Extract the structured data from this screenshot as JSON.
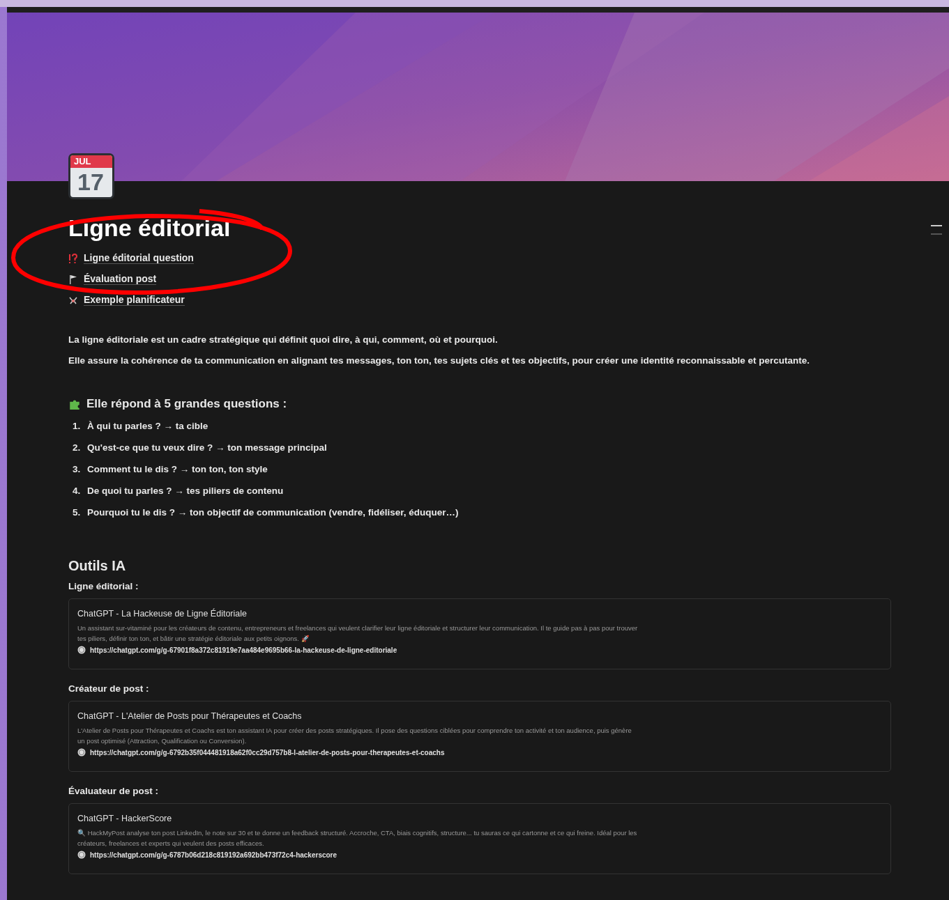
{
  "page": {
    "icon_month": "JUL",
    "icon_day": "17",
    "title": "Ligne éditorial"
  },
  "subpages": [
    {
      "kind": "question",
      "label": "Ligne éditorial question"
    },
    {
      "kind": "flag",
      "label": "Évaluation post"
    },
    {
      "kind": "carousel",
      "label": "Exemple planificateur"
    }
  ],
  "intro": [
    "La ligne éditoriale est un cadre stratégique qui définit quoi dire, à qui, comment, où et pourquoi.",
    "Elle assure la cohérence de ta communication en alignant tes messages, ton ton, tes sujets clés et tes objectifs, pour créer une identité reconnaissable et percutante."
  ],
  "questions": {
    "heading": "Elle répond à 5 grandes questions :",
    "items": [
      {
        "number": "1.",
        "text": "À qui tu parles ? → ta cible"
      },
      {
        "number": "2.",
        "text": "Qu'est-ce que tu veux dire ? → ton message principal"
      },
      {
        "number": "3.",
        "text": "Comment tu le dis ? → ton ton, ton style"
      },
      {
        "number": "4.",
        "text": "De quoi tu parles ? → tes piliers de contenu"
      },
      {
        "number": "5.",
        "text": "Pourquoi tu le dis ? → ton objectif de communication (vendre, fidéliser, éduquer…)"
      }
    ]
  },
  "tools": {
    "heading": "Outils IA",
    "sections": [
      {
        "label": "Ligne éditorial :",
        "title": "ChatGPT - La Hackeuse de Ligne Éditoriale",
        "description": "Un assistant sur-vitaminé pour les créateurs de contenu, entrepreneurs et freelances qui veulent clarifier leur ligne éditoriale et structurer leur communication. Il te guide pas à pas pour trouver tes piliers, définir ton ton, et bâtir une stratégie éditoriale aux petits oignons. 🚀",
        "url": "https://chatgpt.com/g/g-67901f8a372c81919e7aa484e9695b66-la-hackeuse-de-ligne-editoriale"
      },
      {
        "label": "Créateur de post :",
        "title": "ChatGPT - L'Atelier de Posts pour Thérapeutes et Coachs",
        "description": "L'Atelier de Posts pour Thérapeutes et Coachs est ton assistant IA pour créer des posts stratégiques. Il pose des questions ciblées pour comprendre ton activité et ton audience, puis génère un post optimisé (Attraction, Qualification ou Conversion).",
        "url": "https://chatgpt.com/g/g-6792b35f044481918a62f0cc29d757b8-l-atelier-de-posts-pour-therapeutes-et-coachs"
      },
      {
        "label": "Évaluateur de post :",
        "title": "ChatGPT - HackerScore",
        "description": "🔍 HackMyPost analyse ton post LinkedIn, le note sur 30 et te donne un feedback structuré. Accroche, CTA, biais cognitifs, structure... tu sauras ce qui cartonne et ce qui freine. Idéal pour les créateurs, freelances et experts qui veulent des posts efficaces.",
        "url": "https://chatgpt.com/g/g-6787b06d218c819192a692bb473f72c4-hackerscore"
      }
    ]
  }
}
